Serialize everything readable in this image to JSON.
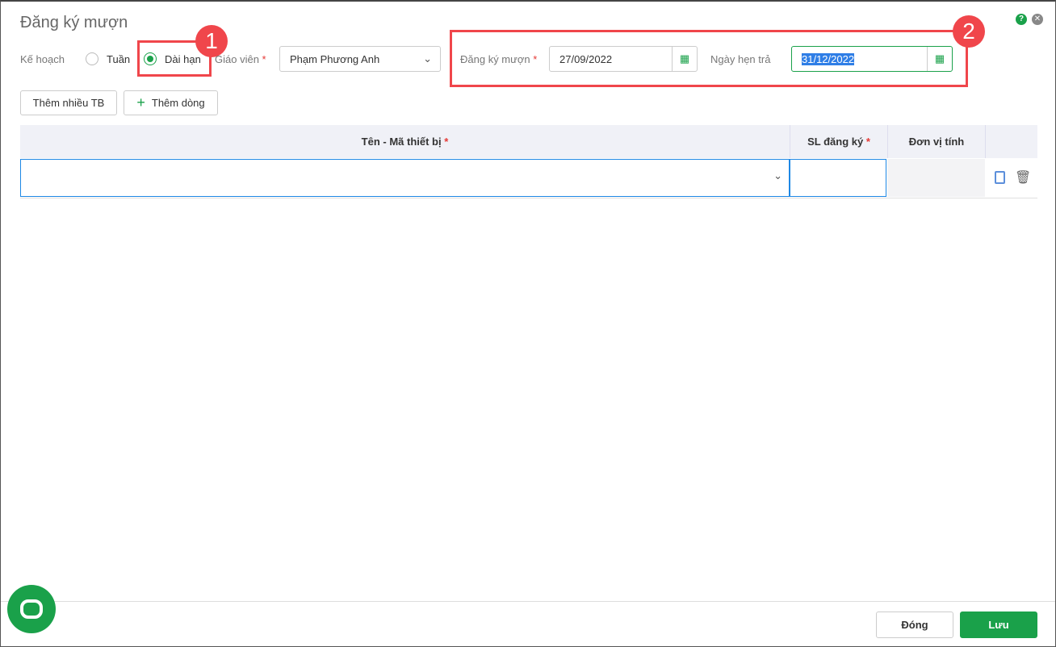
{
  "title": "Đăng ký mượn",
  "ke_hoach_label": "Kế hoạch",
  "radio_tuan": "Tuần",
  "radio_dai_han": "Dài hạn",
  "giao_vien_label": "Giáo viên",
  "giao_vien_value": "Phạm Phương Anh",
  "dang_ky_muon_label": "Đăng ký mượn",
  "dang_ky_muon_value": "27/09/2022",
  "ngay_hen_tra_label": "Ngày hẹn trả",
  "ngay_hen_tra_value": "31/12/2022",
  "required_mark": "*",
  "btn_them_nhieu": "Thêm nhiều TB",
  "btn_them_dong": "Thêm dòng",
  "columns": [
    "Tên - Mã thiết bị",
    "SL đăng ký",
    "Đơn vị tính"
  ],
  "badges": [
    "1",
    "2"
  ],
  "btn_dong": "Đóng",
  "btn_luu": "Lưu",
  "colors": {
    "accent": "#1aa14a",
    "annotation": "#f0464b",
    "focus": "#1e88e5"
  }
}
